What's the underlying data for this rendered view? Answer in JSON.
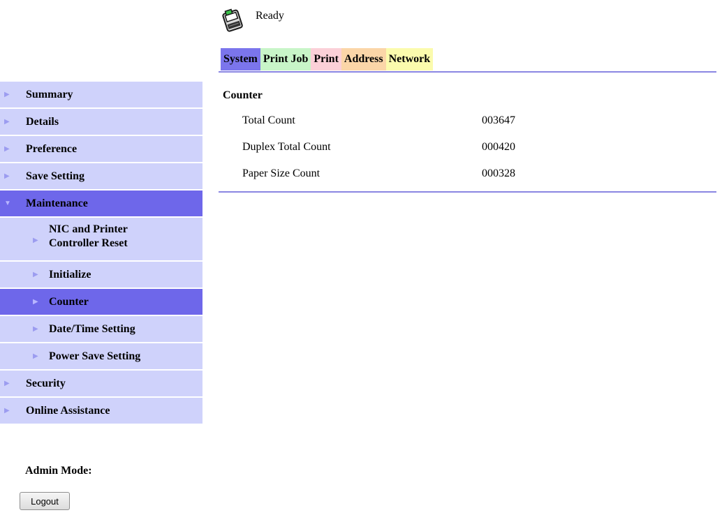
{
  "header": {
    "status": "Ready",
    "icon": "printer-ready-icon"
  },
  "tabs": [
    {
      "label": "System",
      "color": "#7b75ec"
    },
    {
      "label": "Print Job",
      "color": "#c8f5c8"
    },
    {
      "label": "Print",
      "color": "#fbd0d8"
    },
    {
      "label": "Address",
      "color": "#fbd6a8"
    },
    {
      "label": "Network",
      "color": "#fbfbad"
    }
  ],
  "sidebar": {
    "items": [
      {
        "label": "Summary"
      },
      {
        "label": "Details"
      },
      {
        "label": "Preference"
      },
      {
        "label": "Save Setting"
      },
      {
        "label": "Maintenance"
      },
      {
        "label": "Security"
      },
      {
        "label": "Online Assistance"
      }
    ],
    "maintenance_subitems": [
      {
        "label_line1": "NIC and Printer",
        "label_line2": "Controller Reset"
      },
      {
        "label": "Initialize"
      },
      {
        "label": "Counter"
      },
      {
        "label": "Date/Time Setting"
      },
      {
        "label": "Power Save Setting"
      }
    ],
    "colors": {
      "item_bg": "#cfd2fb",
      "active_bg": "#6e67ea"
    }
  },
  "admin": {
    "label": "Admin Mode:",
    "logout": "Logout"
  },
  "content": {
    "title": "Counter",
    "rows": [
      {
        "label": "Total Count",
        "value": "003647"
      },
      {
        "label": "Duplex Total Count",
        "value": "000420"
      },
      {
        "label": "Paper Size Count",
        "value": "000328"
      }
    ]
  }
}
